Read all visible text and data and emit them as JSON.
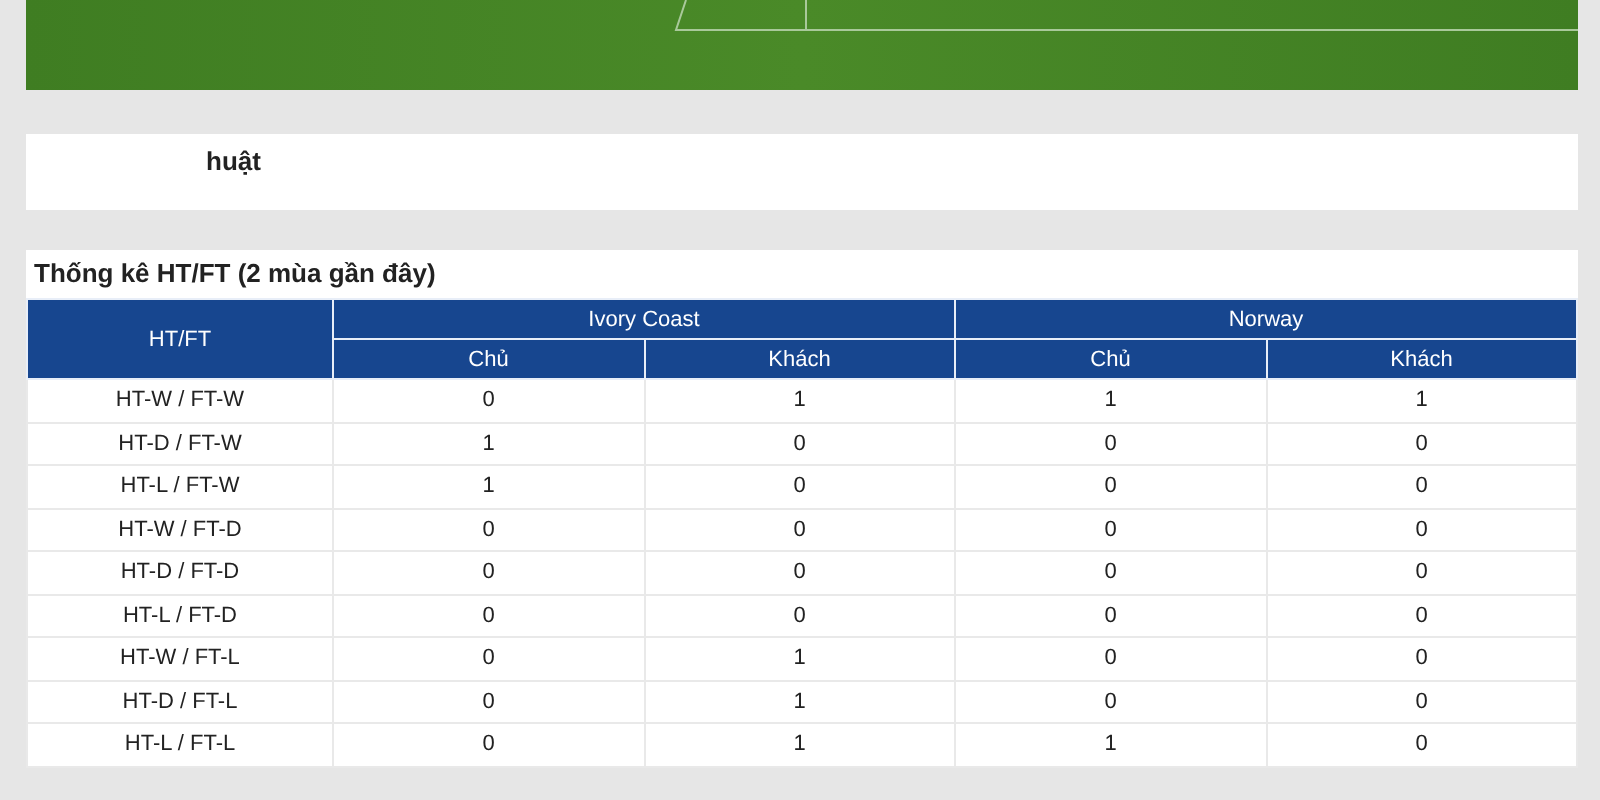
{
  "section_1": {
    "title": "huật"
  },
  "stats": {
    "title": "Thống kê HT/FT (2 mùa gần đây)",
    "table": {
      "corner": "HT/FT",
      "teams": [
        {
          "name": "Ivory Coast",
          "columns": [
            "Chủ",
            "Khách"
          ]
        },
        {
          "name": "Norway",
          "columns": [
            "Chủ",
            "Khách"
          ]
        }
      ],
      "rows": [
        {
          "label": "HT-W / FT-W",
          "cells": [
            "0",
            "1",
            "1",
            "1"
          ]
        },
        {
          "label": "HT-D / FT-W",
          "cells": [
            "1",
            "0",
            "0",
            "0"
          ]
        },
        {
          "label": "HT-L / FT-W",
          "cells": [
            "1",
            "0",
            "0",
            "0"
          ]
        },
        {
          "label": "HT-W / FT-D",
          "cells": [
            "0",
            "0",
            "0",
            "0"
          ]
        },
        {
          "label": "HT-D / FT-D",
          "cells": [
            "0",
            "0",
            "0",
            "0"
          ]
        },
        {
          "label": "HT-L / FT-D",
          "cells": [
            "0",
            "0",
            "0",
            "0"
          ]
        },
        {
          "label": "HT-W / FT-L",
          "cells": [
            "0",
            "1",
            "0",
            "0"
          ]
        },
        {
          "label": "HT-D / FT-L",
          "cells": [
            "0",
            "1",
            "0",
            "0"
          ]
        },
        {
          "label": "HT-L / FT-L",
          "cells": [
            "0",
            "1",
            "1",
            "0"
          ]
        }
      ]
    }
  }
}
